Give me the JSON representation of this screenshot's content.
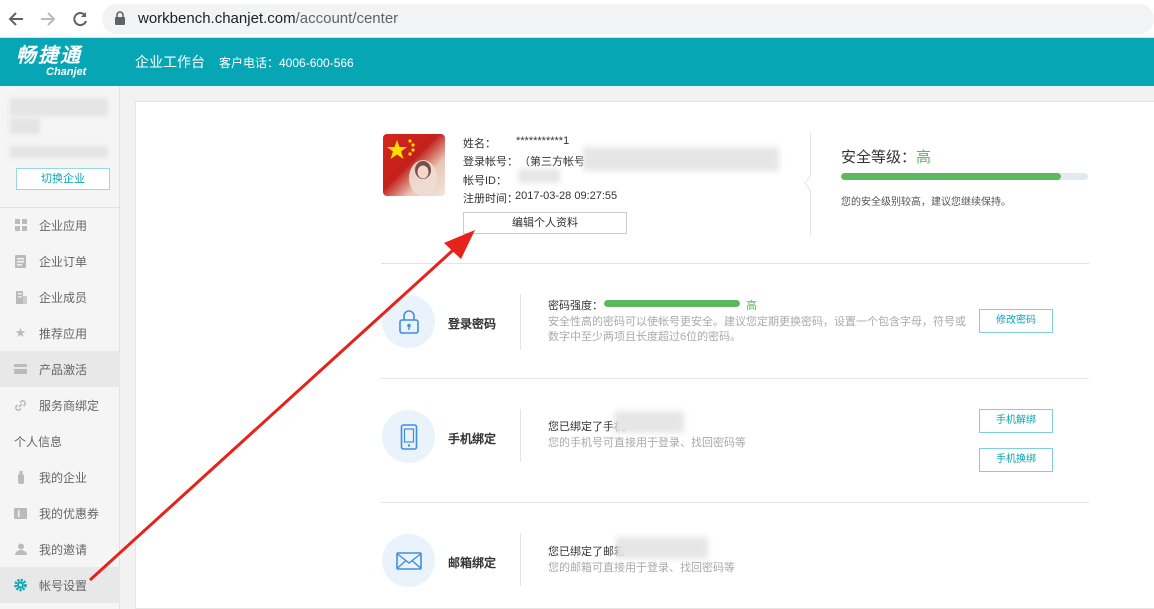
{
  "browser": {
    "url_domain": "workbench.chanjet.com",
    "url_path": "/account/center"
  },
  "header": {
    "logo_cn": "畅捷通",
    "logo_en": "Chanjet",
    "app_title": "企业工作台",
    "hotline": "客户电话：4006-600-566",
    "color": "#07a6b5"
  },
  "sidebar": {
    "switch_label": "切换企业",
    "items": [
      {
        "label": "企业应用",
        "icon": "grid-icon"
      },
      {
        "label": "企业订单",
        "icon": "document-icon"
      },
      {
        "label": "企业成员",
        "icon": "building-icon"
      },
      {
        "label": "推荐应用",
        "icon": "star-icon"
      },
      {
        "label": "产品激活",
        "icon": "card-icon"
      },
      {
        "label": "服务商绑定",
        "icon": "link-icon"
      }
    ],
    "section_label": "个人信息",
    "personal_items": [
      {
        "label": "我的企业",
        "icon": "bottle-icon"
      },
      {
        "label": "我的优惠券",
        "icon": "coupon-icon"
      },
      {
        "label": "我的邀请",
        "icon": "person-icon"
      },
      {
        "label": "帐号设置",
        "icon": "gear-icon"
      }
    ]
  },
  "profile": {
    "name_label": "姓名：",
    "name_value": "***********1",
    "account_label": "登录帐号：",
    "account_value": "（第三方帐号",
    "id_label": "帐号ID：",
    "reg_label": "注册时间：",
    "reg_value": "2017-03-28 09:27:55",
    "edit_button": "编辑个人资料"
  },
  "security": {
    "title": "安全等级：",
    "level": "高",
    "level_fraction": 0.89,
    "desc": "您的安全级别较高，建议您继续保持。",
    "accent": "#5cb85c"
  },
  "password": {
    "title": "登录密码",
    "strength_label": "密码强度：",
    "strength_level": "高",
    "strength_fraction": 1.0,
    "desc_line1": "安全性高的密码可以使帐号更安全。建议您定期更换密码，设置一个包含字母，符号或",
    "desc_line2": "数字中至少两项且长度超过6位的密码。",
    "button": "修改密码"
  },
  "phone": {
    "title": "手机绑定",
    "bound_text": "您已绑定了手机",
    "desc": "您的手机号可直接用于登录、找回密码等",
    "unbind_button": "手机解绑",
    "change_button": "手机换绑"
  },
  "email": {
    "title": "邮箱绑定",
    "bound_text": "您已绑定了邮箱",
    "desc": "您的邮箱可直接用于登录、找回密码等"
  }
}
